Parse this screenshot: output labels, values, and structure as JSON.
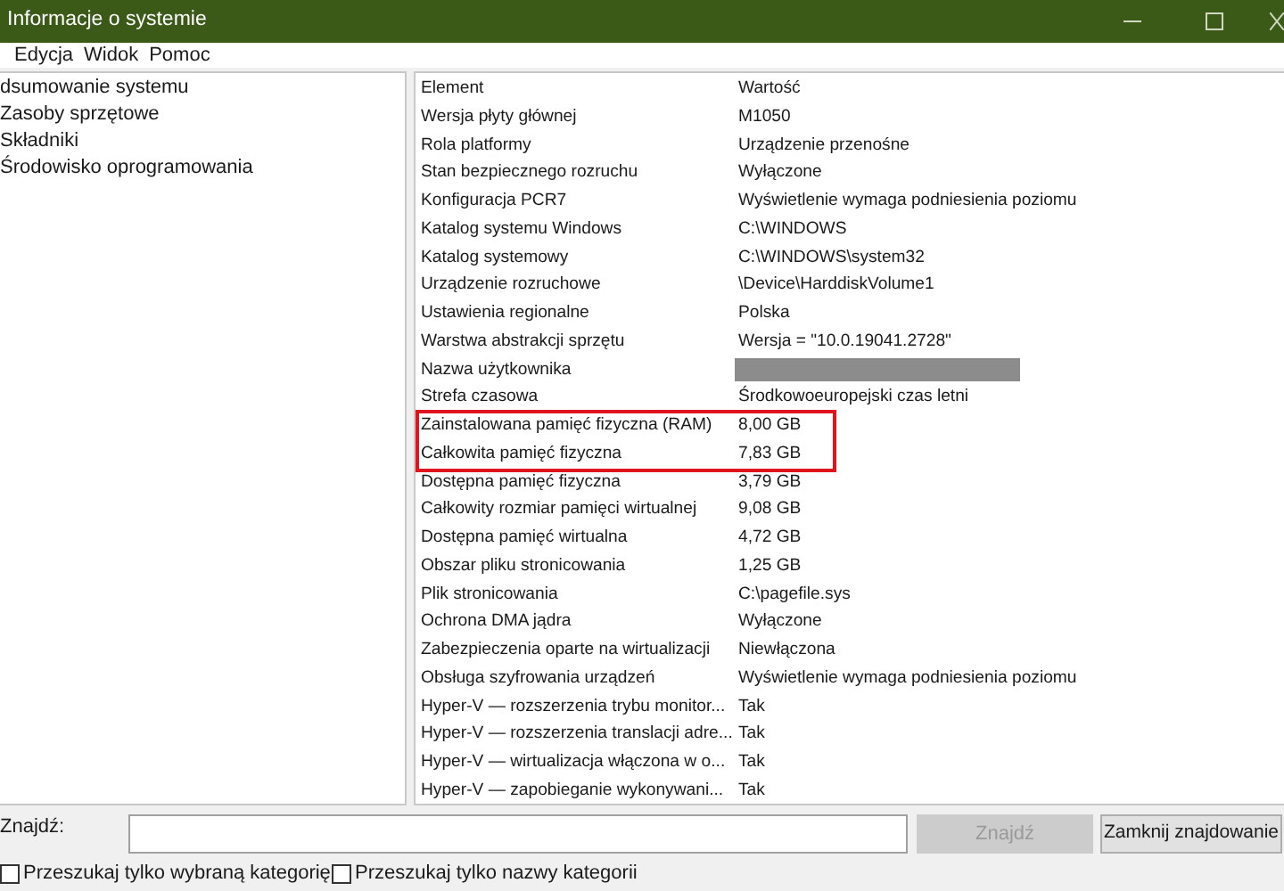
{
  "window": {
    "title": "Informacje o systemie"
  },
  "menu": [
    {
      "label": "Edycja"
    },
    {
      "label": "Widok"
    },
    {
      "label": "Pomoc"
    }
  ],
  "tree": [
    {
      "label": "dsumowanie systemu",
      "selected": false
    },
    {
      "label": "Zasoby sprzętowe",
      "selected": false
    },
    {
      "label": "Składniki",
      "selected": false
    },
    {
      "label": "Środowisko oprogramowania",
      "selected": false
    }
  ],
  "table": {
    "columns": [
      "Element",
      "Wartość"
    ],
    "rows": [
      {
        "element": "Wersja płyty głównej",
        "value": "M1050",
        "highlighted": false
      },
      {
        "element": "Rola platformy",
        "value": "Urządzenie przenośne",
        "highlighted": false
      },
      {
        "element": "Stan bezpiecznego rozruchu",
        "value": "Wyłączone",
        "highlighted": false
      },
      {
        "element": "Konfiguracja PCR7",
        "value": "Wyświetlenie wymaga podniesienia poziomu",
        "highlighted": false
      },
      {
        "element": "Katalog systemu Windows",
        "value": "C:\\WINDOWS",
        "highlighted": false
      },
      {
        "element": "Katalog systemowy",
        "value": "C:\\WINDOWS\\system32",
        "highlighted": false
      },
      {
        "element": "Urządzenie rozruchowe",
        "value": "\\Device\\HarddiskVolume1",
        "highlighted": false
      },
      {
        "element": "Ustawienia regionalne",
        "value": "Polska",
        "highlighted": false
      },
      {
        "element": "Warstwa abstrakcji sprzętu",
        "value": "Wersja = \"10.0.19041.2728\"",
        "highlighted": false
      },
      {
        "element": "Nazwa użytkownika",
        "kind": "redacted",
        "highlighted": false
      },
      {
        "element": "Strefa czasowa",
        "value": "Środkowoeuropejski czas letni",
        "highlighted": false
      },
      {
        "element": "Zainstalowana pamięć fizyczna (RAM)",
        "value": "8,00 GB",
        "highlighted": true
      },
      {
        "element": "Całkowita pamięć fizyczna",
        "value": "7,83 GB",
        "highlighted": true
      },
      {
        "element": "Dostępna pamięć fizyczna",
        "value": "3,79 GB",
        "highlighted": false
      },
      {
        "element": "Całkowity rozmiar pamięci wirtualnej",
        "value": "9,08 GB",
        "highlighted": false
      },
      {
        "element": "Dostępna pamięć wirtualna",
        "value": "4,72 GB",
        "highlighted": false
      },
      {
        "element": "Obszar pliku stronicowania",
        "value": "1,25 GB",
        "highlighted": false
      },
      {
        "element": "Plik stronicowania",
        "value": "C:\\pagefile.sys",
        "highlighted": false
      },
      {
        "element": "Ochrona DMA jądra",
        "value": "Wyłączone",
        "highlighted": false
      },
      {
        "element": "Zabezpieczenia oparte na wirtualizacji",
        "value": "Niewłączona",
        "highlighted": false
      },
      {
        "element": "Obsługa szyfrowania urządzeń",
        "value": "Wyświetlenie wymaga podniesienia poziomu",
        "highlighted": false
      },
      {
        "element": "Hyper-V — rozszerzenia trybu monitor...",
        "value": "Tak",
        "highlighted": false
      },
      {
        "element": "Hyper-V — rozszerzenia translacji adre...",
        "value": "Tak",
        "highlighted": false
      },
      {
        "element": "Hyper-V — wirtualizacja włączona w o...",
        "value": "Tak",
        "highlighted": false
      },
      {
        "element": "Hyper-V — zapobieganie wykonywani...",
        "value": "Tak",
        "highlighted": false
      }
    ]
  },
  "find": {
    "label": "Znajdź:",
    "find_button": {
      "label": "Znajdź",
      "disabled": true
    },
    "close_button": {
      "label": "Zamknij znajdowanie",
      "disabled": false
    },
    "options": [
      {
        "label": "Przeszukaj tylko wybraną kategorię",
        "checked": false
      },
      {
        "label": "Przeszukaj tylko nazwy kategorii",
        "checked": false
      }
    ]
  }
}
